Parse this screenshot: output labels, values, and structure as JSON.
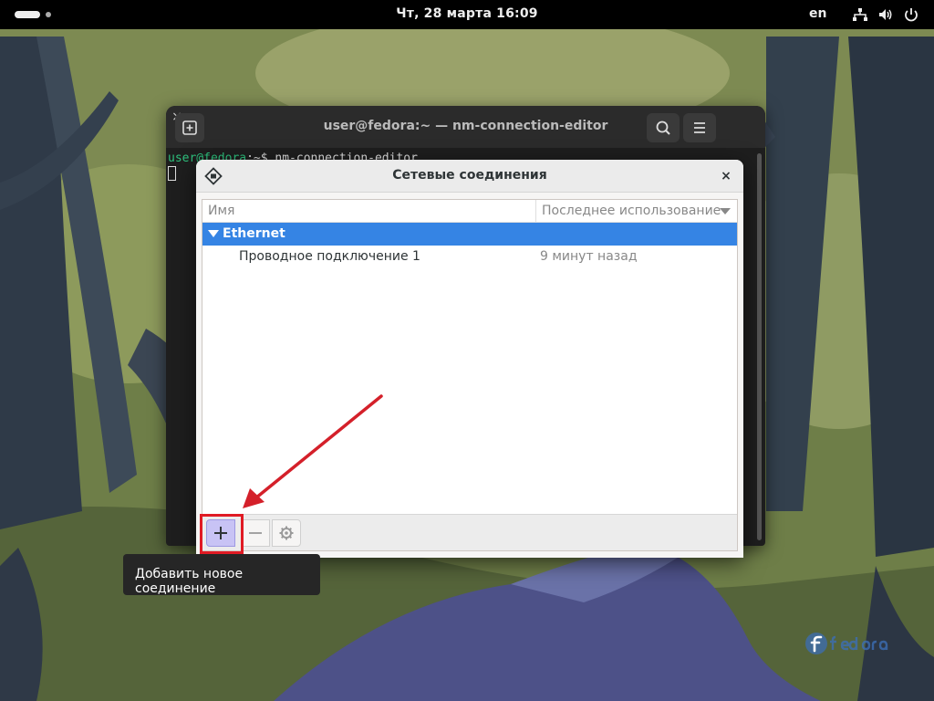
{
  "topbar": {
    "datetime": "Чт, 28 марта  16:09",
    "keyboard_layout": "en"
  },
  "terminal": {
    "title": "user@fedora:~ — nm-connection-editor",
    "prompt_user": "user@fedora",
    "prompt_rest": ":~$ nm-connection-editor",
    "close_glyph": "×"
  },
  "dialog": {
    "title": "Сетевые соединения",
    "close_glyph": "×",
    "columns": {
      "name": "Имя",
      "last_used": "Последнее использование"
    },
    "group": {
      "label": "Ethernet"
    },
    "connections": [
      {
        "name": "Проводное подключение 1",
        "last_used": "9 минут назад"
      }
    ],
    "toolbar": {
      "add_icon": "plus-icon",
      "remove_icon": "minus-icon",
      "edit_icon": "gear-icon"
    }
  },
  "tooltip": {
    "text": "Добавить новое соединение"
  },
  "colors": {
    "selection": "#3584e4",
    "highlight": "#e01b24",
    "terminal_bg": "#1e1e1e"
  }
}
